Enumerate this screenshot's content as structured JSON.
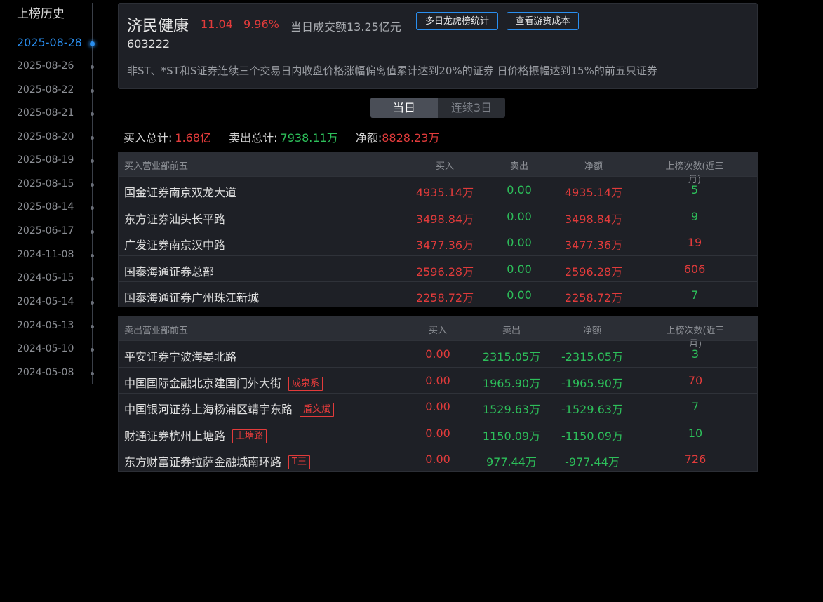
{
  "sidebar": {
    "title": "上榜历史",
    "dates": [
      "2025-08-28",
      "2025-08-26",
      "2025-08-22",
      "2025-08-21",
      "2025-08-20",
      "2025-08-19",
      "2025-08-15",
      "2025-08-14",
      "2025-06-17",
      "2024-11-08",
      "2024-05-15",
      "2024-05-14",
      "2024-05-13",
      "2024-05-10",
      "2024-05-08"
    ],
    "active_index": 0
  },
  "stock": {
    "name": "济民健康",
    "price": "11.04",
    "change": "9.96%",
    "turnover": "当日成交额13.25亿元",
    "code": "603222",
    "reason": "非ST、*ST和S证券连续三个交易日内收盘价格涨幅偏离值累计达到20%的证券 日价格振幅达到15%的前五只证券"
  },
  "buttons": {
    "multi_day": "多日龙虎榜统计",
    "trader_cost": "查看游资成本"
  },
  "toggle": {
    "today": "当日",
    "three_day": "连续3日",
    "selected": "当日"
  },
  "summary": {
    "buy_label": "买入总计:",
    "buy_value": "1.68亿",
    "sell_label": "卖出总计:",
    "sell_value": "7938.11万",
    "net_label": "净额:",
    "net_value": "8828.23万"
  },
  "buy_table": {
    "headers": [
      "买入营业部前五",
      "买入",
      "卖出",
      "净额",
      "上榜次数(近三月)"
    ],
    "rows": [
      {
        "name": "国金证券南京双龙大道",
        "tag": "",
        "buy": "4935.14万",
        "sell": "0.00",
        "net": "4935.14万",
        "count": "5"
      },
      {
        "name": "东方证券汕头长平路",
        "tag": "",
        "buy": "3498.84万",
        "sell": "0.00",
        "net": "3498.84万",
        "count": "9"
      },
      {
        "name": "广发证券南京汉中路",
        "tag": "",
        "buy": "3477.36万",
        "sell": "0.00",
        "net": "3477.36万",
        "count": "19"
      },
      {
        "name": "国泰海通证券总部",
        "tag": "",
        "buy": "2596.28万",
        "sell": "0.00",
        "net": "2596.28万",
        "count": "606"
      },
      {
        "name": "国泰海通证券广州珠江新城",
        "tag": "",
        "buy": "2258.72万",
        "sell": "0.00",
        "net": "2258.72万",
        "count": "7"
      }
    ]
  },
  "sell_table": {
    "headers": [
      "卖出营业部前五",
      "买入",
      "卖出",
      "净额",
      "上榜次数(近三月)"
    ],
    "rows": [
      {
        "name": "平安证券宁波海晏北路",
        "tag": "",
        "buy": "0.00",
        "sell": "2315.05万",
        "net": "-2315.05万",
        "count": "3"
      },
      {
        "name": "中国国际金融北京建国门外大街",
        "tag": "成泉系",
        "buy": "0.00",
        "sell": "1965.90万",
        "net": "-1965.90万",
        "count": "70"
      },
      {
        "name": "中国银河证券上海杨浦区靖宇东路",
        "tag": "盾文斌",
        "buy": "0.00",
        "sell": "1529.63万",
        "net": "-1529.63万",
        "count": "7"
      },
      {
        "name": "财通证券杭州上塘路",
        "tag": "上塘路",
        "buy": "0.00",
        "sell": "1150.09万",
        "net": "-1150.09万",
        "count": "10"
      },
      {
        "name": "东方财富证券拉萨金融城南环路",
        "tag": "T王",
        "buy": "0.00",
        "sell": "977.44万",
        "net": "-977.44万",
        "count": "726"
      }
    ]
  },
  "colors": {
    "up": "#e23b3b",
    "down": "#2dbf5a",
    "accent": "#2a8ff0",
    "panel": "#1e2026",
    "header": "#2b2e35"
  }
}
